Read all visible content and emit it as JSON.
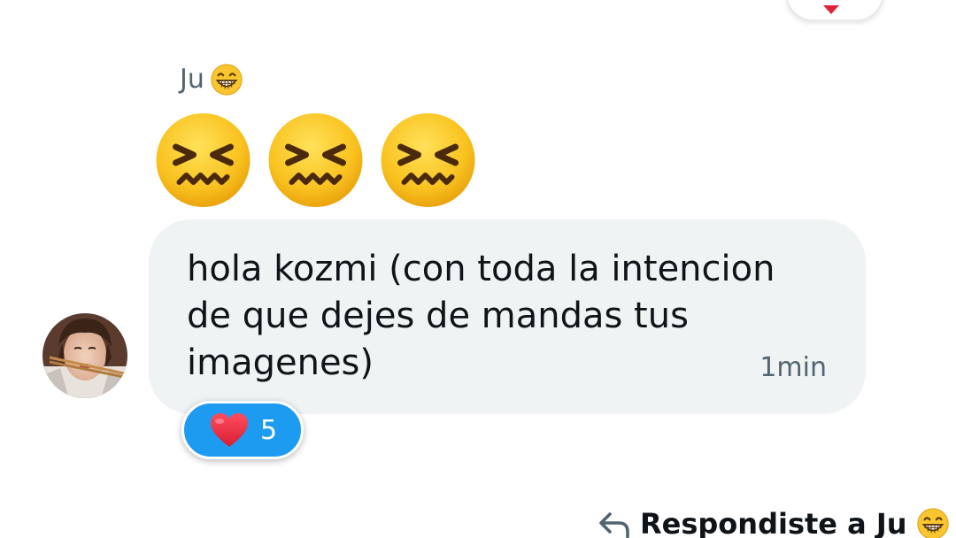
{
  "previous_message": {
    "reaction_icon": "heart-icon"
  },
  "message": {
    "sender_name": "Ju",
    "sender_emoji": "beaming-face-icon",
    "sticker_emojis": [
      "confounded-face-icon",
      "confounded-face-icon",
      "confounded-face-icon"
    ],
    "text": "hola kozmi (con toda la intencion\nde que dejes de mandas tus\nimagenes)",
    "timestamp": "1min",
    "reaction": {
      "icon": "heart-icon",
      "count": "5"
    }
  },
  "reply_note": {
    "label": "Respondiste a Ju",
    "icon": "reply-arrow-icon",
    "emoji": "beaming-face-icon"
  },
  "colors": {
    "bubble_bg": "#eff3f4",
    "accent": "#1d9bf0",
    "secondary_text": "#536471",
    "primary_text": "#0f1419",
    "heart": "#e0243a"
  }
}
